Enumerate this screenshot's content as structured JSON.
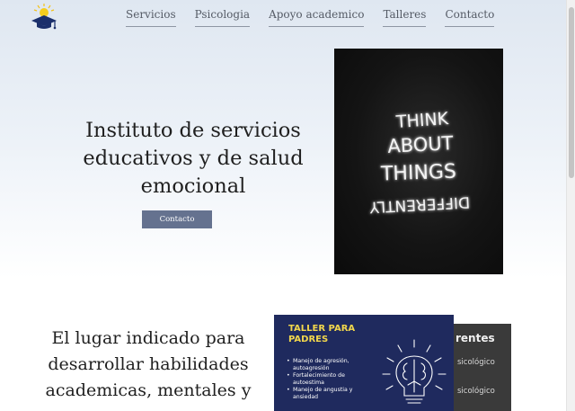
{
  "nav": {
    "items": [
      "Servicios",
      "Psicologia",
      "Apoyo academico",
      "Talleres",
      "Contacto"
    ]
  },
  "hero": {
    "title_lines": [
      "Instituto de servicios",
      "educativos y de salud",
      "emocional"
    ],
    "button_label": "Contacto",
    "image_text": [
      "THINK",
      "ABOUT",
      "THINGS",
      "DIFFERENTLY"
    ]
  },
  "section": {
    "title_lines": [
      "El lugar indicado para",
      "desarrollar habilidades",
      "academicas, mentales y"
    ]
  },
  "taller_card": {
    "title_lines": [
      "TALLER PARA",
      "PADRES"
    ],
    "items": [
      "Manejo de agresión, autoagresión",
      "Fortalecimiento de autoestima",
      "Manejo de angustia y ansiedad"
    ]
  },
  "chalk_card": {
    "title": "rentes",
    "lines": [
      "sicológico",
      "sicológico"
    ]
  },
  "icons": {
    "logo": "graduation-cap-lightbulb-icon",
    "brain": "brain-lightbulb-icon"
  },
  "colors": {
    "button": "#65728f",
    "card_bg": "#1f2a5e",
    "card_title": "#f2d74c",
    "neon_bg": "#141414"
  }
}
